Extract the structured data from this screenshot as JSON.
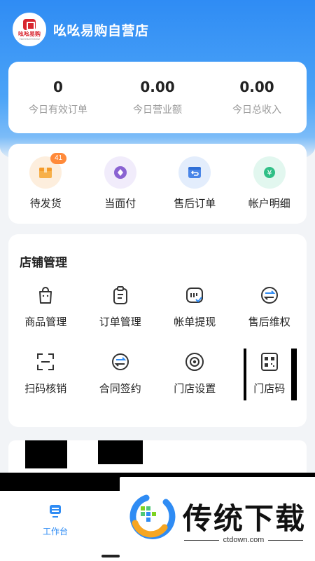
{
  "store": {
    "name": "吆吆易购自营店",
    "logo_text": "吆吆易购",
    "logo_sub": "YAOYAOYIGOU"
  },
  "stats": [
    {
      "value": "0",
      "label": "今日有效订单"
    },
    {
      "value": "0.00",
      "label": "今日营业额"
    },
    {
      "value": "0.00",
      "label": "今日总收入"
    }
  ],
  "quick_actions": [
    {
      "label": "待发货",
      "icon": "box-icon",
      "badge": "41"
    },
    {
      "label": "当面付",
      "icon": "diamond-icon"
    },
    {
      "label": "售后订单",
      "icon": "return-icon"
    },
    {
      "label": "帐户明细",
      "icon": "yen-icon"
    }
  ],
  "store_management": {
    "title": "店铺管理",
    "items": [
      {
        "label": "商品管理",
        "icon": "bag-icon"
      },
      {
        "label": "订单管理",
        "icon": "clipboard-icon"
      },
      {
        "label": "帐单提现",
        "icon": "bill-icon"
      },
      {
        "label": "售后维权",
        "icon": "exchange-icon"
      },
      {
        "label": "扫码核销",
        "icon": "scan-icon"
      },
      {
        "label": "合同签约",
        "icon": "contract-icon"
      },
      {
        "label": "门店设置",
        "icon": "settings-icon"
      },
      {
        "label": "门店码",
        "icon": "qrcode-icon"
      }
    ]
  },
  "tabbar": {
    "workbench_label": "工作台"
  },
  "watermark": {
    "title": "传统下载",
    "url": "ctdown.com"
  },
  "colors": {
    "primary": "#2f8cf4",
    "badge": "#ff8a3a",
    "logo_red": "#d8262f"
  }
}
